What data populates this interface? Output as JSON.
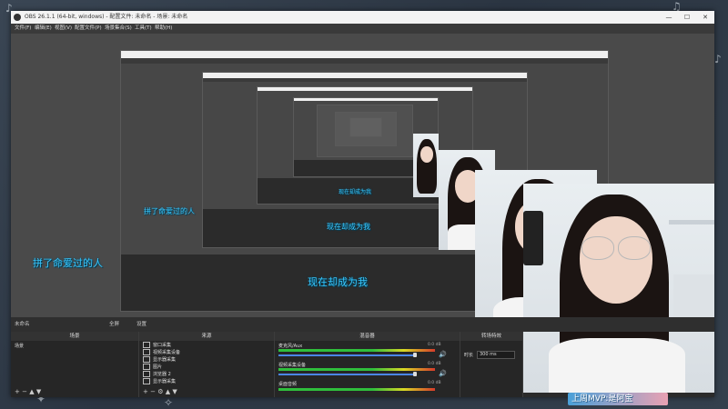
{
  "window": {
    "title": "OBS 26.1.1 (64-bit, windows) - 配置文件: 未命名 - 场景: 未命名",
    "minimize": "—",
    "maximize": "☐",
    "close": "✕"
  },
  "menu": [
    "文件(F)",
    "编辑(E)",
    "视图(V)",
    "配置文件(P)",
    "场景集合(S)",
    "工具(T)",
    "帮助(H)"
  ],
  "captions": {
    "left_large": "拼了命爱过的人",
    "left_medium": "拼了命爱过的人",
    "center_large": "现在却成为我",
    "center_medium": "现在却成为我",
    "center_small": "现在却成为我"
  },
  "docks_bar": {
    "scene_label": "未命名",
    "stats": "全屏",
    "properties": "设置"
  },
  "docks": {
    "scenes": {
      "header": "场景",
      "items": [
        "场景"
      ]
    },
    "sources": {
      "header": "来源",
      "items": [
        "窗口采集",
        "视频采集设备",
        "显示器采集",
        "图片",
        "浏览器 2",
        "显示器采集"
      ]
    },
    "mixer": {
      "header": "混音器",
      "channels": [
        {
          "name": "麦克风/Aux",
          "db": "0.0 dB"
        },
        {
          "name": "视频采集设备",
          "db": "0.0 dB"
        },
        {
          "name": "桌面音频",
          "db": "0.0 dB"
        }
      ]
    },
    "transitions": {
      "header": "转场特效",
      "label": "时长",
      "value": "300 ms"
    }
  },
  "overlay": {
    "danmaku": "上周MVP:是阿宝"
  },
  "colors": {
    "caption": "#38c7ff",
    "obs_dark": "#2b2b2b",
    "meter_green": "#2fbf3c"
  }
}
